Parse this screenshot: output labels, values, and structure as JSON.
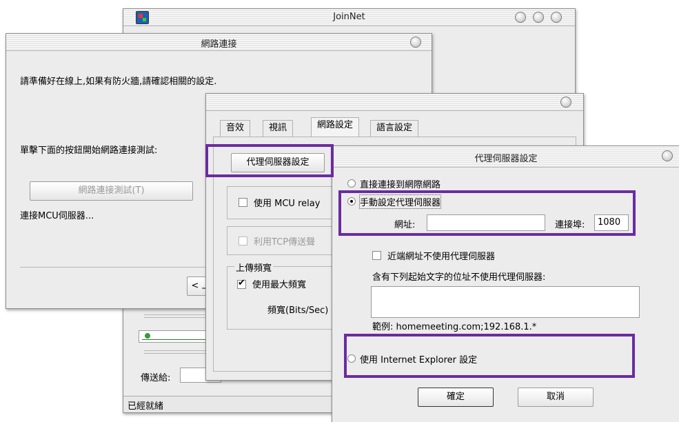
{
  "joinnet": {
    "title": "JoinNet",
    "send_to_label": "傳送給:",
    "status": "已經就緒"
  },
  "network_dialog": {
    "title": "網路連接",
    "intro": "請準備好在線上,如果有防火牆,請確認相關的設定.",
    "instruction": "單擊下面的按鈕開始網路連接測試:",
    "test_button": "網路連接測試(T)",
    "connect_status": "連接MCU伺服器...",
    "back_button": "< 上"
  },
  "settings_dialog": {
    "tabs": [
      "音效",
      "視訊",
      "網路設定",
      "語言設定"
    ],
    "proxy_settings_button": "代理伺服器設定",
    "use_mcu_relay": "使用 MCU relay",
    "use_tcp": "利用TCP傳送聲",
    "upload_group_title": "上傳頻寬",
    "use_max_bandwidth": "使用最大頻寬",
    "use_max_bandwidth_checked": true,
    "bandwidth_label": "頻寬(Bits/Sec)"
  },
  "proxy_dialog": {
    "title": "代理伺服器設定",
    "option_direct": "直接連接到網際網路",
    "option_manual": "手動設定代理伺服器",
    "selected_option": "manual",
    "address_label": "網址:",
    "address_value": "",
    "port_label": "連接埠:",
    "port_value": "1080",
    "no_proxy_local": "近端網址不使用代理伺服器",
    "exclude_label": "含有下列起始文字的位址不使用代理伺服器:",
    "exclude_value": "",
    "example": "範例: homemeeting.com;192.168.1.*",
    "option_ie": "使用 Internet Explorer 設定",
    "ok_button": "確定",
    "cancel_button": "取消"
  },
  "colors": {
    "highlight": "#6a2ca0",
    "window_bg": "#ececec"
  }
}
